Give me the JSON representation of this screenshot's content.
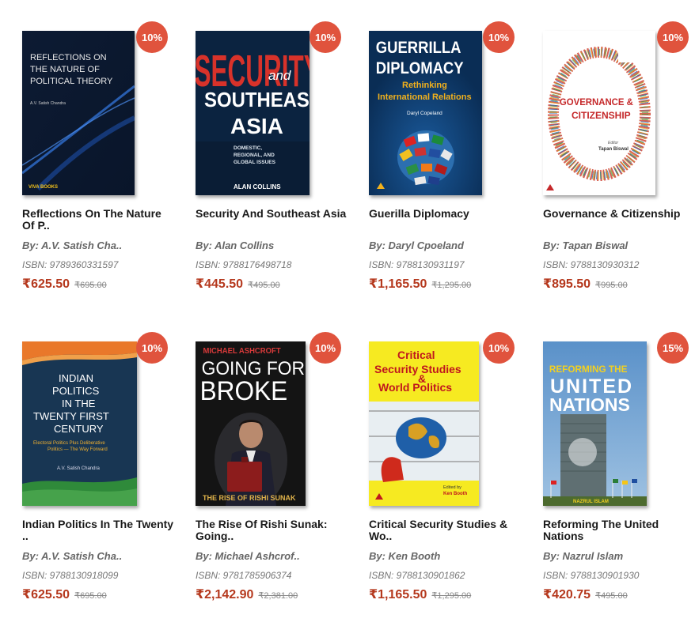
{
  "books": [
    {
      "discount": "10%",
      "title": "Reflections On The Nature Of P..",
      "author": "By: A.V. Satish Cha..",
      "isbn": "ISBN: 9789360331597",
      "price": "₹625.50",
      "mrp": "₹695.00",
      "cover": {
        "lines": [
          "REFLECTIONS ON",
          "THE NATURE OF",
          "POLITICAL THEORY"
        ],
        "author": "A.V. Satish Chandra",
        "publisher": "VIVA BOOKS"
      }
    },
    {
      "discount": "10%",
      "title": "Security And Southeast Asia",
      "author": "By: Alan Collins",
      "isbn": "ISBN: 9788176498718",
      "price": "₹445.50",
      "mrp": "₹495.00",
      "cover": {
        "big": "SECURITY",
        "and": "and",
        "line2": "SOUTHEAST",
        "line3": "ASIA",
        "sub": [
          "DOMESTIC,",
          "REGIONAL, AND",
          "GLOBAL ISSUES"
        ],
        "author": "ALAN COLLINS"
      }
    },
    {
      "discount": "10%",
      "title": "Guerilla Diplomacy",
      "author": "By: Daryl Cpoeland",
      "isbn": "ISBN: 9788130931197",
      "price": "₹1,165.50",
      "mrp": "₹1,295.00",
      "cover": {
        "line1": "GUERRILLA",
        "line2": "DIPLOMACY",
        "sub": [
          "Rethinking",
          "International Relations"
        ],
        "author": "Daryl Copeland"
      }
    },
    {
      "discount": "10%",
      "title": "Governance & Citizenship",
      "author": "By: Tapan Biswal",
      "isbn": "ISBN: 9788130930312",
      "price": "₹895.50",
      "mrp": "₹995.00",
      "cover": {
        "line1": "GOVERNANCE &",
        "line2": "CITIZENSHIP",
        "editor": "Editor",
        "author": "Tapan Biswal"
      }
    },
    {
      "discount": "10%",
      "title": "Indian Politics In The Twenty ..",
      "author": "By: A.V. Satish Cha..",
      "isbn": "ISBN: 9788130918099",
      "price": "₹625.50",
      "mrp": "₹695.00",
      "cover": {
        "lines": [
          "INDIAN",
          "POLITICS",
          "IN THE",
          "TWENTY FIRST",
          "CENTURY"
        ],
        "sub": [
          "Electoral Politics Plus Deliberative",
          "Politics — The Way Forward"
        ],
        "author": "A.V. Satish Chandra"
      }
    },
    {
      "discount": "10%",
      "title": "The Rise Of Rishi Sunak: Going..",
      "author": "By: Michael Ashcrof..",
      "isbn": "ISBN: 9781785906374",
      "price": "₹2,142.90",
      "mrp": "₹2,381.00",
      "cover": {
        "author": "MICHAEL ASHCROFT",
        "line1": "GOING FOR",
        "line2": "BROKE",
        "sub": "THE RISE OF RISHI SUNAK"
      }
    },
    {
      "discount": "10%",
      "title": "Critical Security Studies & Wo..",
      "author": "By: Ken Booth",
      "isbn": "ISBN: 9788130901862",
      "price": "₹1,165.50",
      "mrp": "₹1,295.00",
      "cover": {
        "lines": [
          "Critical",
          "Security Studies",
          "&",
          "World Politics"
        ],
        "edited": "Edited by",
        "author": "Ken Booth"
      }
    },
    {
      "discount": "15%",
      "title": "Reforming The United Nations",
      "author": "By: Nazrul Islam",
      "isbn": "ISBN: 9788130901930",
      "price": "₹420.75",
      "mrp": "₹495.00",
      "cover": {
        "line1": "REFORMING THE",
        "line2": "UNITED",
        "line3": "NATIONS",
        "author": "NAZRUL ISLAM"
      }
    }
  ]
}
